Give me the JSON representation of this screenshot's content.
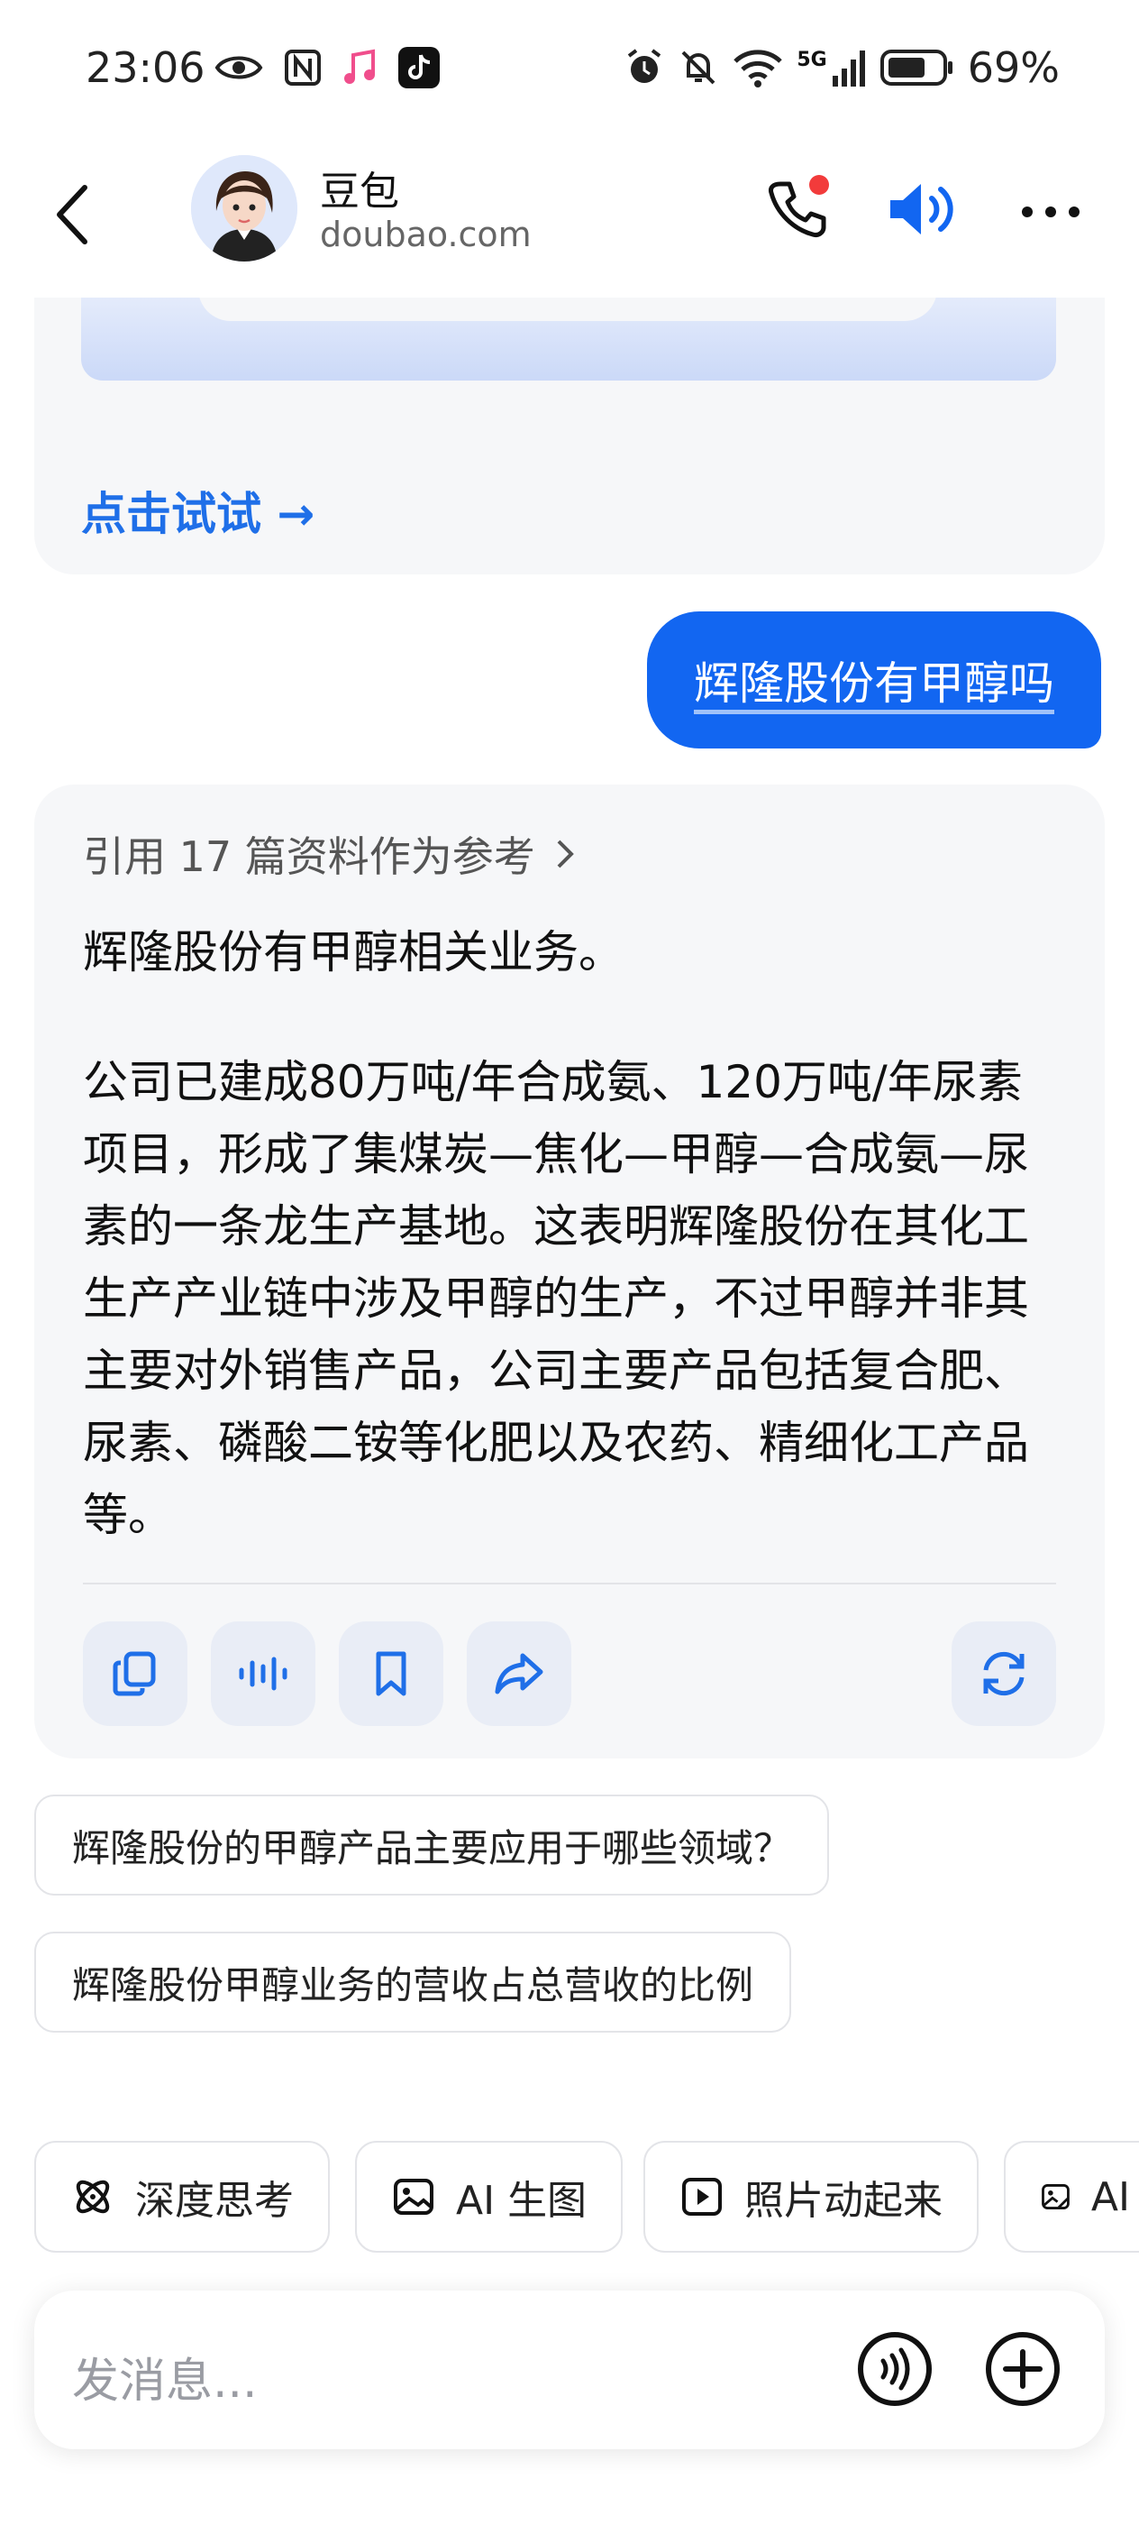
{
  "status_bar": {
    "time": "23:06",
    "network": "5G",
    "battery": "69%"
  },
  "header": {
    "name": "豆包",
    "subtitle": "doubao.com"
  },
  "prev_card": {
    "try_link": "点击试试 →"
  },
  "user_message": "辉隆股份有甲醇吗",
  "answer": {
    "references": "引用 17 篇资料作为参考",
    "paragraph1": "辉隆股份有甲醇相关业务。",
    "paragraph2": "公司已建成80万吨/年合成氨、120万吨/年尿素项目，形成了集煤炭—焦化—甲醇—合成氨—尿素的一条龙生产基地。这表明辉隆股份在其化工生产产业链中涉及甲醇的生产，不过甲醇并非其主要对外销售产品，公司主要产品包括复合肥、尿素、磷酸二铵等化肥以及农药、精细化工产品等。"
  },
  "suggestions": [
    "辉隆股份的甲醇产品主要应用于哪些领域？",
    "辉隆股份甲醇业务的营收占总营收的比例"
  ],
  "features": [
    {
      "label": "深度思考",
      "icon": "atom-icon"
    },
    {
      "label": "AI 生图",
      "icon": "image-icon"
    },
    {
      "label": "照片动起来",
      "icon": "play-icon"
    },
    {
      "label": "AI",
      "icon": "image-edit-icon"
    }
  ],
  "input": {
    "placeholder": "发消息..."
  },
  "colors": {
    "accent": "#1266f1",
    "link": "#1f6fe8",
    "card_bg": "#f6f7f9",
    "notification_dot": "#f23b3b"
  }
}
